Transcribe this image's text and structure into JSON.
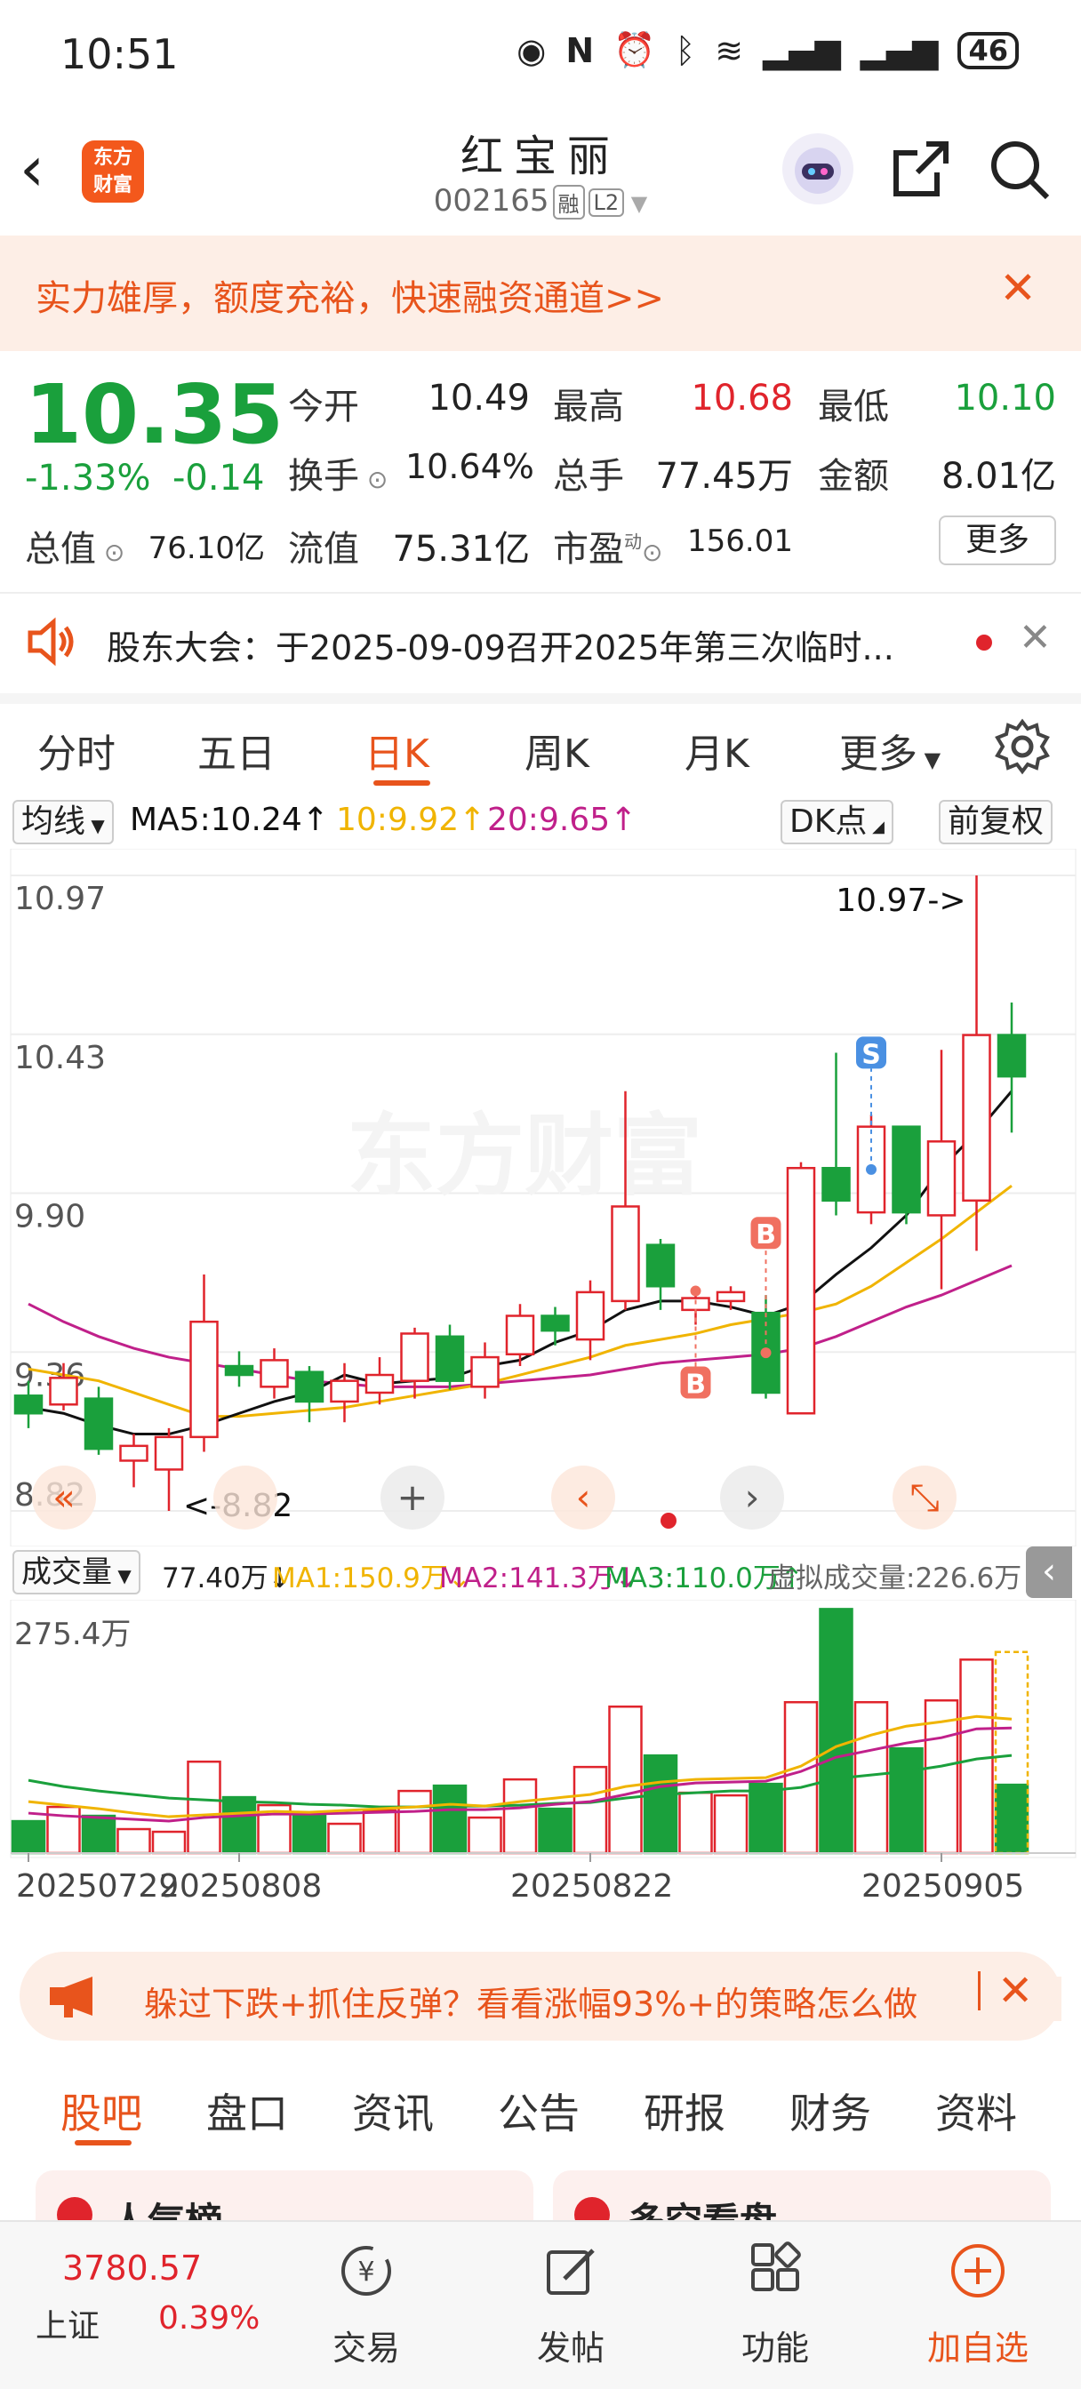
{
  "status": {
    "time": "10:51",
    "battery": "46"
  },
  "header": {
    "title": "红宝丽",
    "code": "002165",
    "tag_margin": "融",
    "tag_level": "L2",
    "logo_line1": "东方",
    "logo_line2": "财富"
  },
  "banner_top": {
    "text": "实力雄厚，额度充裕，快速融资通道>>"
  },
  "quote": {
    "price": "10.35",
    "change_pct": "-1.33%",
    "change_abs": "-0.14",
    "open_label": "今开",
    "open": "10.49",
    "high_label": "最高",
    "high": "10.68",
    "low_label": "最低",
    "low": "10.10",
    "turnover_label": "换手",
    "turnover": "10.64%",
    "volume_label": "总手",
    "volume": "77.45万",
    "amount_label": "金额",
    "amount": "8.01亿",
    "mktcap_label": "总值",
    "mktcap": "76.10亿",
    "float_label": "流值",
    "float": "75.31亿",
    "pe_label": "市盈",
    "pe_sup": "动",
    "pe": "156.01",
    "more": "更多"
  },
  "notice": {
    "text": "股东大会：于2025-09-09召开2025年第三次临时..."
  },
  "chart_tabs": [
    "分时",
    "五日",
    "日K",
    "周K",
    "月K",
    "更多"
  ],
  "active_chart_tab": "日K",
  "ma_bar": {
    "selector": "均线",
    "ma5": "MA5:10.24↑",
    "ma10": "10:9.92↑",
    "ma20": "20:9.65↑",
    "dk": "DK点",
    "adjust": "前复权"
  },
  "vol_bar": {
    "selector": "成交量",
    "vol": "77.40万↓",
    "ma1": "MA1:150.9万↓",
    "ma2": "MA2:141.3万↓",
    "ma3": "MA3:110.0万↑",
    "virtual": "虚拟成交量:226.6万"
  },
  "colors": {
    "up": "#e0242c",
    "down": "#1aa03c",
    "accent": "#e8541c",
    "ma5": "#111111",
    "ma10": "#f0b400",
    "ma20": "#c0208a"
  },
  "chart_data": {
    "type": "candlestick",
    "y_ticks": [
      "10.97",
      "10.43",
      "9.90",
      "9.36",
      "8.82"
    ],
    "ylim": [
      8.82,
      10.97
    ],
    "max_label": "10.97->",
    "min_label": "<-8.82",
    "watermark": "东方财富",
    "candles": [
      {
        "o": 9.21,
        "c": 9.15,
        "h": 9.26,
        "l": 9.1
      },
      {
        "o": 9.18,
        "c": 9.27,
        "h": 9.32,
        "l": 9.16
      },
      {
        "o": 9.2,
        "c": 9.03,
        "h": 9.24,
        "l": 9.01
      },
      {
        "o": 8.99,
        "c": 9.04,
        "h": 9.08,
        "l": 8.9
      },
      {
        "o": 8.96,
        "c": 9.07,
        "h": 9.1,
        "l": 8.82
      },
      {
        "o": 9.07,
        "c": 9.46,
        "h": 9.62,
        "l": 9.02
      },
      {
        "o": 9.31,
        "c": 9.28,
        "h": 9.36,
        "l": 9.24
      },
      {
        "o": 9.24,
        "c": 9.33,
        "h": 9.37,
        "l": 9.2
      },
      {
        "o": 9.29,
        "c": 9.19,
        "h": 9.31,
        "l": 9.12
      },
      {
        "o": 9.19,
        "c": 9.26,
        "h": 9.32,
        "l": 9.12
      },
      {
        "o": 9.22,
        "c": 9.28,
        "h": 9.34,
        "l": 9.18
      },
      {
        "o": 9.26,
        "c": 9.42,
        "h": 9.44,
        "l": 9.2
      },
      {
        "o": 9.41,
        "c": 9.26,
        "h": 9.45,
        "l": 9.23
      },
      {
        "o": 9.24,
        "c": 9.34,
        "h": 9.39,
        "l": 9.2
      },
      {
        "o": 9.35,
        "c": 9.48,
        "h": 9.52,
        "l": 9.31
      },
      {
        "o": 9.48,
        "c": 9.43,
        "h": 9.51,
        "l": 9.38
      },
      {
        "o": 9.4,
        "c": 9.56,
        "h": 9.6,
        "l": 9.33
      },
      {
        "o": 9.53,
        "c": 9.85,
        "h": 10.24,
        "l": 9.5
      },
      {
        "o": 9.72,
        "c": 9.58,
        "h": 9.74,
        "l": 9.5
      },
      {
        "o": 9.5,
        "c": 9.54,
        "h": 9.57,
        "l": 9.45
      },
      {
        "o": 9.53,
        "c": 9.56,
        "h": 9.58,
        "l": 9.5
      },
      {
        "o": 9.49,
        "c": 9.22,
        "h": 9.55,
        "l": 9.2
      },
      {
        "o": 9.15,
        "c": 9.98,
        "h": 10.0,
        "l": 9.15
      },
      {
        "o": 9.98,
        "c": 9.87,
        "h": 10.37,
        "l": 9.82
      },
      {
        "o": 9.83,
        "c": 10.12,
        "h": 10.16,
        "l": 9.79
      },
      {
        "o": 10.12,
        "c": 9.83,
        "h": 10.12,
        "l": 9.79
      },
      {
        "o": 9.82,
        "c": 10.07,
        "h": 10.38,
        "l": 9.57
      },
      {
        "o": 9.87,
        "c": 10.43,
        "h": 10.97,
        "l": 9.7
      },
      {
        "o": 10.43,
        "c": 10.29,
        "h": 10.54,
        "l": 10.1
      }
    ],
    "ma5": [
      9.17,
      9.15,
      9.11,
      9.08,
      9.08,
      9.11,
      9.15,
      9.19,
      9.22,
      9.28,
      9.25,
      9.26,
      9.27,
      9.31,
      9.33,
      9.39,
      9.43,
      9.5,
      9.53,
      9.53,
      9.51,
      9.48,
      9.52,
      9.62,
      9.71,
      9.82,
      9.98,
      10.1,
      10.24
    ],
    "ma10": [
      9.3,
      9.28,
      9.26,
      9.22,
      9.18,
      9.14,
      9.14,
      9.15,
      9.16,
      9.17,
      9.19,
      9.21,
      9.23,
      9.25,
      9.28,
      9.31,
      9.34,
      9.38,
      9.4,
      9.42,
      9.45,
      9.47,
      9.49,
      9.52,
      9.58,
      9.66,
      9.74,
      9.83,
      9.92
    ],
    "ma20": [
      9.52,
      9.46,
      9.41,
      9.37,
      9.34,
      9.32,
      9.3,
      9.28,
      9.26,
      9.25,
      9.24,
      9.24,
      9.24,
      9.25,
      9.26,
      9.27,
      9.28,
      9.3,
      9.32,
      9.33,
      9.34,
      9.35,
      9.37,
      9.41,
      9.46,
      9.51,
      9.55,
      9.6,
      9.65
    ],
    "markers": [
      {
        "i": 19,
        "label": "B",
        "pos": "below"
      },
      {
        "i": 21,
        "label": "B",
        "pos": "above"
      },
      {
        "i": 24,
        "label": "S",
        "pos": "above"
      }
    ],
    "volume": {
      "max_label": "275.4万",
      "ylim": [
        0,
        275.4
      ],
      "values": [
        36,
        52,
        42,
        27,
        24,
        103,
        63,
        54,
        42,
        33,
        48,
        70,
        76,
        40,
        83,
        50,
        97,
        165,
        110,
        68,
        65,
        78,
        170,
        275,
        170,
        118,
        172,
        218,
        77
      ],
      "virtual_last": 226.6,
      "ma1": [
        58,
        54,
        50,
        45,
        41,
        43,
        45,
        47,
        46,
        48,
        50,
        52,
        55,
        53,
        58,
        62,
        66,
        75,
        80,
        83,
        84,
        85,
        98,
        120,
        133,
        143,
        148,
        154,
        151
      ],
      "ma2": [
        45,
        42,
        40,
        38,
        36,
        40,
        42,
        44,
        44,
        45,
        46,
        47,
        49,
        49,
        51,
        55,
        58,
        66,
        75,
        79,
        80,
        81,
        92,
        108,
        116,
        124,
        130,
        140,
        141
      ],
      "ma3": [
        82,
        75,
        70,
        66,
        62,
        60,
        58,
        57,
        55,
        54,
        52,
        52,
        53,
        53,
        54,
        56,
        57,
        62,
        66,
        68,
        70,
        70,
        74,
        84,
        88,
        92,
        98,
        106,
        110
      ]
    },
    "x_labels": [
      {
        "i": 0,
        "t": "20250729"
      },
      {
        "i": 6,
        "t": "20250808"
      },
      {
        "i": 16,
        "t": "20250822"
      },
      {
        "i": 26,
        "t": "20250905"
      }
    ]
  },
  "banner_bottom": {
    "text": "躲过下跌+抓住反弹？看看涨幅93%+的策略怎么做"
  },
  "sub_tabs": [
    "股吧",
    "盘口",
    "资讯",
    "公告",
    "研报",
    "财务",
    "资料"
  ],
  "cards": [
    {
      "label": "人气榜"
    },
    {
      "label": "多空看盘"
    }
  ],
  "bottom_nav": {
    "index_value": "3780.57",
    "index_name": "上证",
    "index_change": "0.39%",
    "items": [
      "交易",
      "发帖",
      "功能",
      "加自选"
    ]
  }
}
